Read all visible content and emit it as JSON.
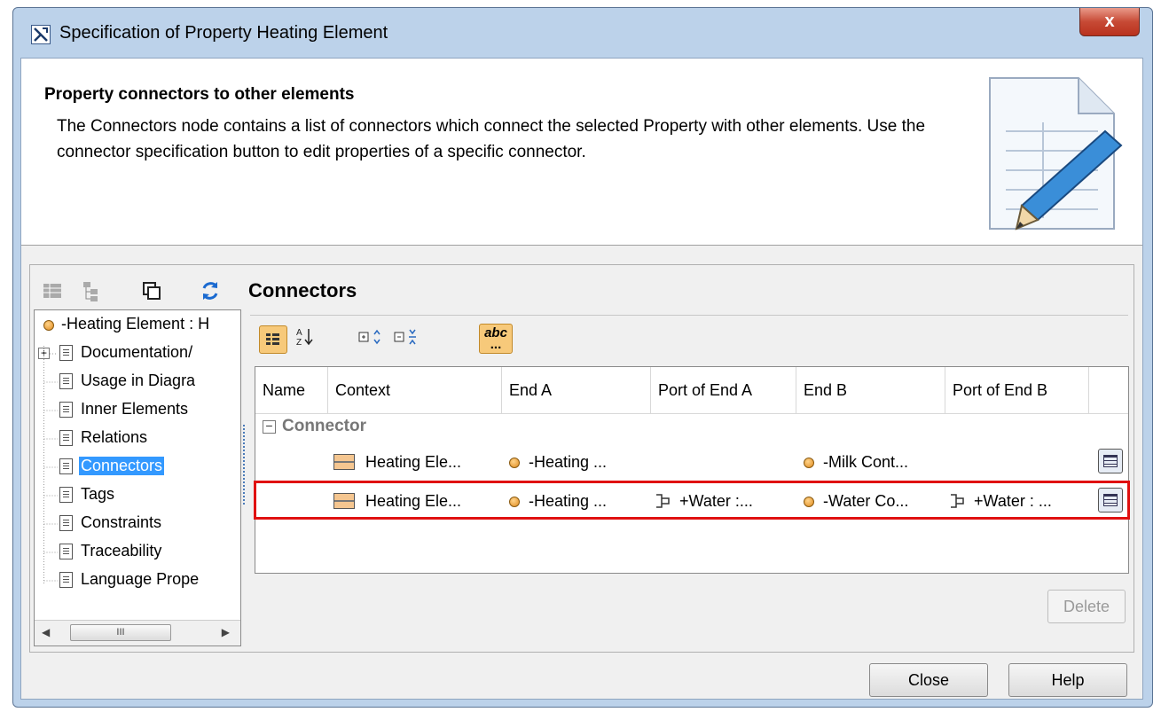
{
  "window": {
    "title": "Specification of Property Heating Element",
    "close_glyph": "x"
  },
  "header": {
    "title": "Property connectors to other elements",
    "description": "The Connectors node contains a list of connectors which connect the selected Property with other elements. Use the connector specification button to edit properties of a specific connector."
  },
  "section_title": "Connectors",
  "tree": {
    "items": [
      {
        "label": "-Heating Element : H",
        "icon": "property-icon"
      },
      {
        "label": "Documentation/",
        "icon": "document-icon",
        "expandable": true
      },
      {
        "label": "Usage in Diagra",
        "icon": "document-icon"
      },
      {
        "label": "Inner Elements",
        "icon": "document-icon"
      },
      {
        "label": "Relations",
        "icon": "document-icon"
      },
      {
        "label": "Connectors",
        "icon": "document-icon",
        "selected": true
      },
      {
        "label": "Tags",
        "icon": "document-icon"
      },
      {
        "label": "Constraints",
        "icon": "document-icon"
      },
      {
        "label": "Traceability",
        "icon": "document-icon"
      },
      {
        "label": "Language Prope",
        "icon": "document-icon"
      }
    ],
    "scroll_glyph": "III"
  },
  "toolbar": {
    "abc_label": "abc",
    "abc_dots": "..."
  },
  "table": {
    "columns": [
      "Name",
      "Context",
      "End A",
      "Port of End A",
      "End B",
      "Port of End B"
    ],
    "group": {
      "toggle": "−",
      "label": "Connector"
    },
    "rows": [
      {
        "name": "",
        "context": "Heating Ele...",
        "end_a": "-Heating ...",
        "port_a": "",
        "end_b": "-Milk Cont...",
        "port_b": ""
      },
      {
        "name": "",
        "context": "Heating Ele...",
        "end_a": "-Heating ...",
        "port_a": "+Water :...",
        "end_b": "-Water Co...",
        "port_b": "+Water : ..."
      }
    ]
  },
  "buttons": {
    "delete": "Delete",
    "close": "Close",
    "help": "Help"
  },
  "colors": {
    "highlight": "#e01010",
    "selection": "#3399ff",
    "toolbar_active": "#f7c97a"
  }
}
